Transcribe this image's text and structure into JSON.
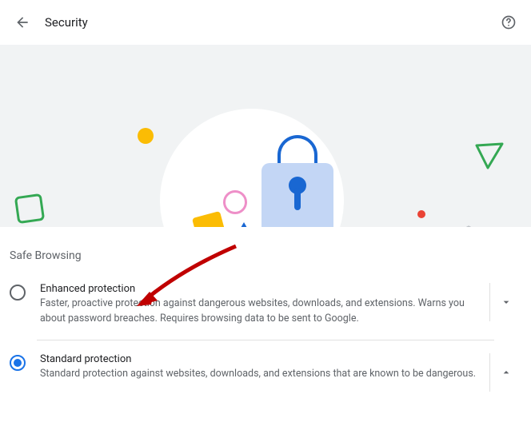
{
  "header": {
    "title": "Security"
  },
  "section": {
    "title": "Safe Browsing"
  },
  "options": {
    "enhanced": {
      "title": "Enhanced protection",
      "desc": "Faster, proactive protection against dangerous websites, downloads, and extensions. Warns you about password breaches. Requires browsing data to be sent to Google.",
      "selected": false
    },
    "standard": {
      "title": "Standard protection",
      "desc": "Standard protection against websites, downloads, and extensions that are known to be dangerous.",
      "selected": true
    }
  }
}
